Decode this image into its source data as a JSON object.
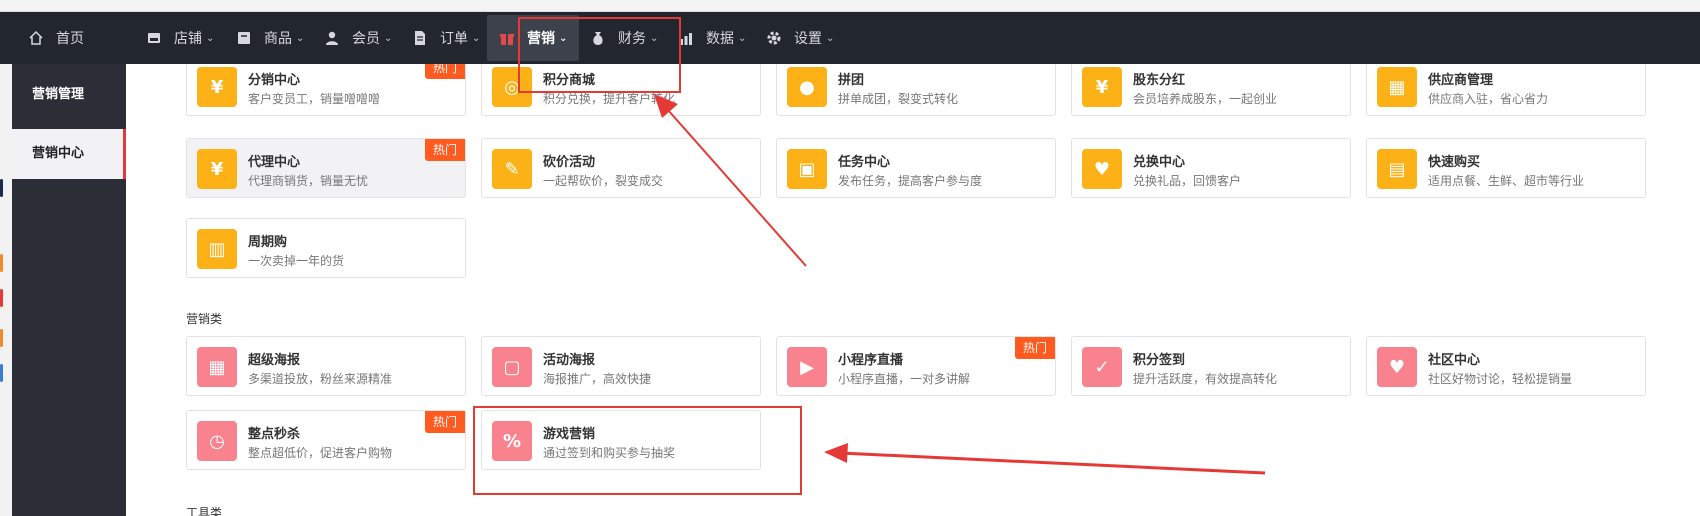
{
  "topbar": {
    "home": "首页",
    "menus": [
      {
        "label": "店铺",
        "icon": "store-icon"
      },
      {
        "label": "商品",
        "icon": "goods-icon"
      },
      {
        "label": "会员",
        "icon": "user-icon"
      },
      {
        "label": "订单",
        "icon": "order-icon"
      },
      {
        "label": "营销",
        "icon": "gift-icon"
      },
      {
        "label": "财务",
        "icon": "money-bag-icon"
      },
      {
        "label": "数据",
        "icon": "chart-icon"
      },
      {
        "label": "设置",
        "icon": "gear-icon"
      }
    ]
  },
  "sidebar": {
    "items": [
      {
        "label": "营销管理"
      },
      {
        "label": "营销中心"
      }
    ]
  },
  "hot_badge": "热门",
  "sections": {
    "marketing_label": "营销类",
    "tools_label": "工具类"
  },
  "cards": {
    "fenxiao": {
      "title": "分销中心",
      "desc": "客户变员工，销量噌噌噌"
    },
    "jifen_mall": {
      "title": "积分商城",
      "desc": "积分兑换，提升客户转化"
    },
    "pintuan": {
      "title": "拼团",
      "desc": "拼单成团，裂变式转化"
    },
    "gudong": {
      "title": "股东分红",
      "desc": "会员培养成股东，一起创业"
    },
    "supplier": {
      "title": "供应商管理",
      "desc": "供应商入驻，省心省力"
    },
    "daili": {
      "title": "代理中心",
      "desc": "代理商销货，销量无忧"
    },
    "kanjia": {
      "title": "砍价活动",
      "desc": "一起帮砍价，裂变成交"
    },
    "task": {
      "title": "任务中心",
      "desc": "发布任务，提高客户参与度"
    },
    "exchange": {
      "title": "兑换中心",
      "desc": "兑换礼品，回馈客户"
    },
    "quickbuy": {
      "title": "快速购买",
      "desc": "适用点餐、生鲜、超市等行业"
    },
    "zhouqi": {
      "title": "周期购",
      "desc": "一次卖掉一年的货"
    },
    "super_poster": {
      "title": "超级海报",
      "desc": "多渠道投放，粉丝来源精准"
    },
    "activity_poster": {
      "title": "活动海报",
      "desc": "海报推广，高效快捷"
    },
    "live": {
      "title": "小程序直播",
      "desc": "小程序直播，一对多讲解"
    },
    "signin": {
      "title": "积分签到",
      "desc": "提升活跃度，有效提高转化"
    },
    "community": {
      "title": "社区中心",
      "desc": "社区好物讨论，轻松提销量"
    },
    "seckill": {
      "title": "整点秒杀",
      "desc": "整点超低价，促进客户购物"
    },
    "game": {
      "title": "游戏营销",
      "desc": "通过签到和购买参与抽奖"
    }
  },
  "colors": {
    "topbar": "#22262e",
    "sidebar": "#2b2e37",
    "hot": "#ff5a1f",
    "orange_icon": "#fcb216",
    "pink_icon": "#f8838f",
    "annotation": "#e53935"
  }
}
